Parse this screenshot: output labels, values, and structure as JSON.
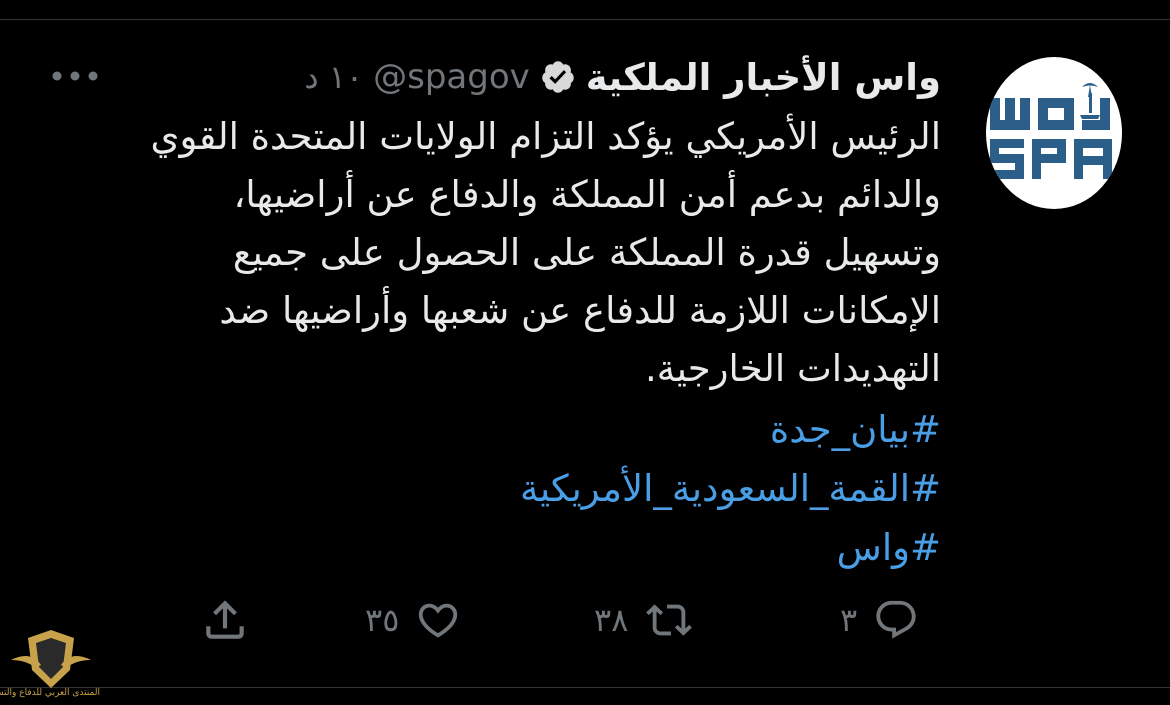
{
  "tweet": {
    "display_name": "واس الأخبار الملكية",
    "handle": "@spagov",
    "time": "١٠ د",
    "body_lines": [
      "الرئيس الأمريكي يؤكد التزام الولايات المتحدة القوي",
      "والدائم بدعم أمن المملكة والدفاع عن أراضيها،",
      "وتسهيل قدرة المملكة على الحصول على جميع",
      "الإمكانات اللازمة للدفاع عن شعبها وأراضيها ضد",
      "التهديدات الخارجية."
    ],
    "hashtags": [
      "#بيان_جدة",
      "#القمة_السعودية_الأمريكية",
      "#واس"
    ]
  },
  "actions": {
    "reply_count": "٣",
    "retweet_count": "٣٨",
    "like_count": "٣٥"
  },
  "avatar": {
    "logo_text_top": "واس",
    "logo_text_bottom": "SPA"
  },
  "watermark": {
    "caption": "المنتدى العربي للدفاع والتسليح"
  },
  "colors": {
    "background": "#000000",
    "text": "#e7e9ea",
    "muted": "#71767b",
    "link": "#4a9ee6",
    "logo_blue": "#2b5f8a"
  },
  "icons": {
    "verified": "verified-badge-icon",
    "more": "more-dots-icon",
    "reply": "reply-bubble-icon",
    "retweet": "retweet-arrows-icon",
    "like": "heart-icon",
    "share": "share-upload-icon"
  }
}
